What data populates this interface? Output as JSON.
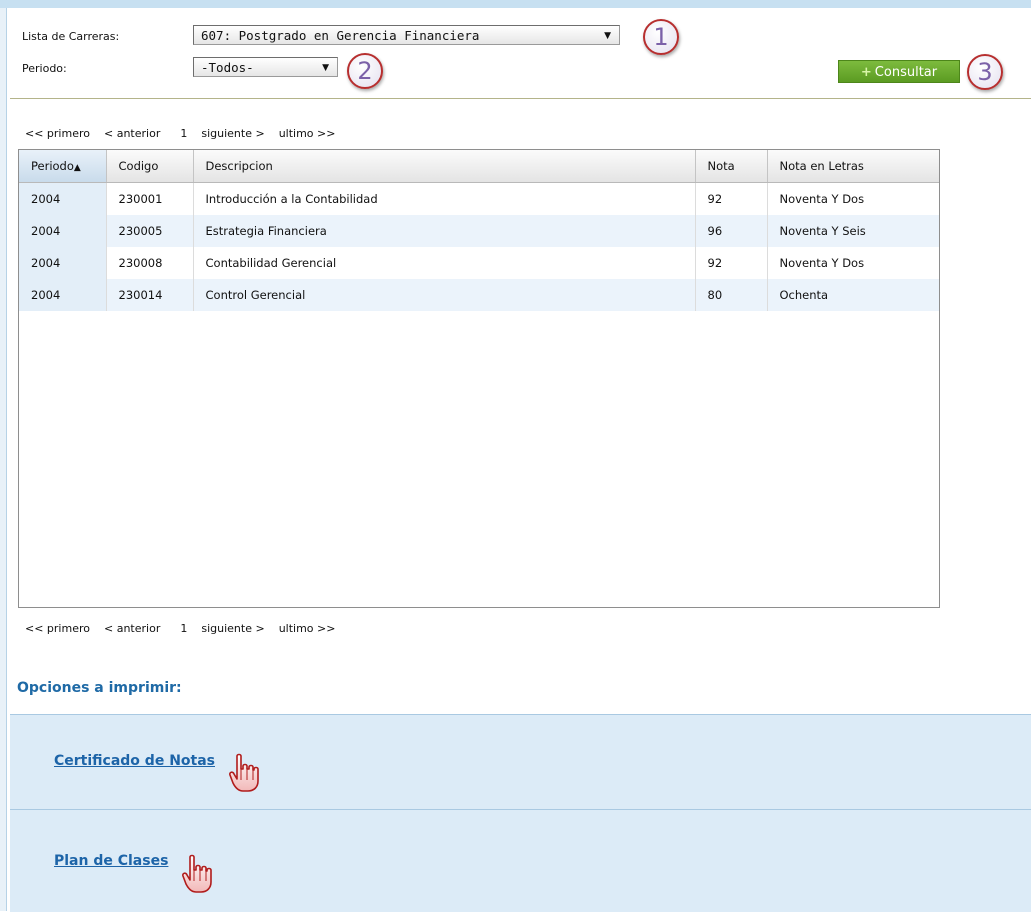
{
  "form": {
    "carreras_label": "Lista de Carreras:",
    "carreras_value": "607: Postgrado en Gerencia Financiera",
    "periodo_label": "Periodo:",
    "periodo_value": "-Todos-",
    "consultar_label": "Consultar"
  },
  "callouts": {
    "one": "1",
    "two": "2",
    "three": "3"
  },
  "pager": {
    "first": "<< primero",
    "prev": "< anterior",
    "page": "1",
    "next": "siguiente >",
    "last": "ultimo >>"
  },
  "table": {
    "headers": [
      "Periodo",
      "Codigo",
      "Descripcion",
      "Nota",
      "Nota en Letras"
    ],
    "sort_indicator": "▲",
    "rows": [
      [
        "2004",
        "230001",
        "Introducción a la Contabilidad",
        "92",
        "Noventa Y Dos"
      ],
      [
        "2004",
        "230005",
        "Estrategia Financiera",
        "96",
        "Noventa Y Seis"
      ],
      [
        "2004",
        "230008",
        "Contabilidad Gerencial",
        "92",
        "Noventa Y Dos"
      ],
      [
        "2004",
        "230014",
        "Control Gerencial",
        "80",
        "Ochenta"
      ]
    ]
  },
  "print_options": {
    "title": "Opciones a imprimir:",
    "certificado": "Certificado de Notas",
    "plan": "Plan de Clases"
  },
  "colors": {
    "accent_green": "#6aa92d",
    "link_blue": "#1d64a8",
    "panel_blue": "#dcebf7",
    "callout_ring": "#b72f2f"
  }
}
